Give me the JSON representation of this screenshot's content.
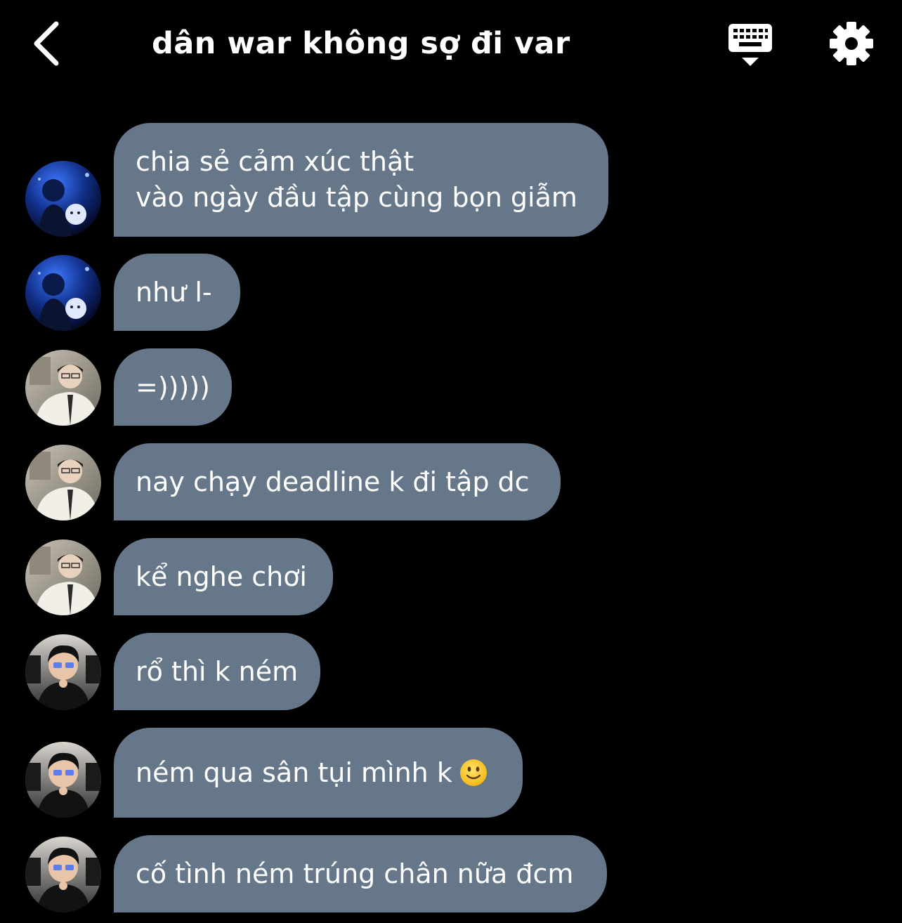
{
  "header": {
    "title": "dân war không sợ đi var",
    "back_icon": "chevron-left-icon",
    "keyboard_icon": "keyboard-icon",
    "settings_icon": "gear-icon"
  },
  "colors": {
    "background": "#000000",
    "bubble": "#66778a",
    "text": "#ffffff"
  },
  "messages": [
    {
      "sender_avatar": "avatar-blue-scene",
      "text": "chia sẻ cảm xúc thật\nvào ngày đầu tập cùng bọn giẫm"
    },
    {
      "sender_avatar": "avatar-blue-scene",
      "text": "như l-"
    },
    {
      "sender_avatar": "avatar-white-jacket",
      "text": "=)))))"
    },
    {
      "sender_avatar": "avatar-white-jacket",
      "text": "nay chạy deadline k đi tập dc"
    },
    {
      "sender_avatar": "avatar-white-jacket",
      "text": "kể nghe chơi"
    },
    {
      "sender_avatar": "avatar-glasses-gaming",
      "text": "rổ thì k ném"
    },
    {
      "sender_avatar": "avatar-glasses-gaming",
      "text": "ném qua sân tụi mình k",
      "emoji": "slightly-smiling-face-icon"
    },
    {
      "sender_avatar": "avatar-glasses-gaming",
      "text": "cố tình ném trúng chân nữa đcm"
    }
  ]
}
